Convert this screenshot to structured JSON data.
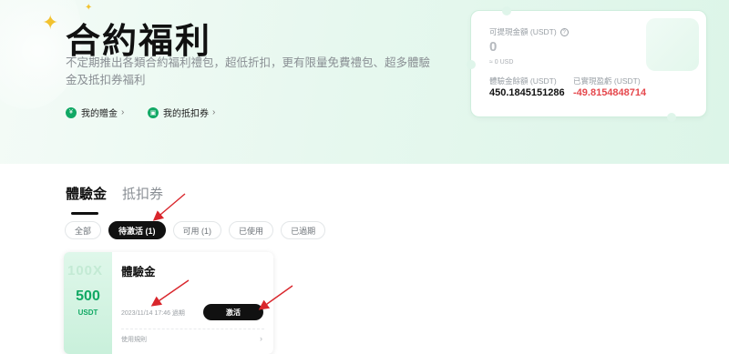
{
  "hero": {
    "title": "合約福利",
    "description": "不定期推出各類合約福利禮包，超低折扣，更有限量免費禮包、超多體驗金及抵扣券福利",
    "links": [
      {
        "label": "我的贈金",
        "icon": "gift-money-icon"
      },
      {
        "label": "我的抵扣券",
        "icon": "voucher-icon"
      }
    ]
  },
  "account": {
    "withdrawable_label": "可提現金額 (USDT)",
    "withdrawable_value": "0",
    "withdrawable_usd": "≈ 0 USD",
    "trial_balance_label": "體驗金餘額 (USDT)",
    "trial_balance_value": "450.1845151286",
    "realized_pnl_label": "已實現盈虧 (USDT)",
    "realized_pnl_value": "-49.8154848714"
  },
  "tabs": [
    {
      "label": "體驗金",
      "active": true
    },
    {
      "label": "抵扣券",
      "active": false
    }
  ],
  "filters": [
    {
      "label": "全部",
      "active": false
    },
    {
      "label": "待激活 (1)",
      "active": true
    },
    {
      "label": "可用 (1)",
      "active": false
    },
    {
      "label": "已使用",
      "active": false
    },
    {
      "label": "已過期",
      "active": false
    }
  ],
  "coupon": {
    "bg_text": "100X",
    "amount": "500",
    "unit": "USDT",
    "title": "體驗金",
    "expiry": "2023/11/14 17:46 過期",
    "activate_label": "激活",
    "rules_label": "使用規則"
  },
  "colors": {
    "accent_green": "#10a863",
    "negative_red": "#e5484d",
    "annotation_red": "#d9262c"
  }
}
